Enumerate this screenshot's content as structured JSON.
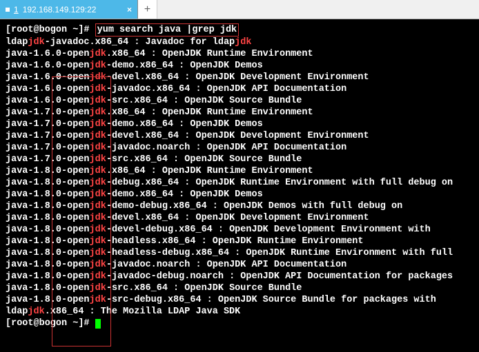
{
  "tab": {
    "index": "1",
    "label": "192.168.149.129:22",
    "close": "×"
  },
  "newtab": "+",
  "prompt": "[root@bogon ~]# ",
  "command": "yum search java |grep jdk",
  "lines": [
    {
      "pre": "ldap",
      "hl": "jdk",
      "mid": "-javadoc.x86_64 : Javadoc for ldap",
      "hl2": "jdk",
      "post": ""
    },
    {
      "pre": "java-1.6.0-open",
      "hl": "jdk",
      "mid": ".x86_64 : OpenJDK Runtime Environment",
      "hl2": "",
      "post": ""
    },
    {
      "pre": "java-1.6.0-open",
      "hl": "jdk",
      "mid": "-demo.x86_64 : OpenJDK Demos",
      "hl2": "",
      "post": ""
    },
    {
      "pre": "java-1.6.0-open",
      "hl": "jdk",
      "mid": "-devel.x86_64 : OpenJDK Development Environment",
      "hl2": "",
      "post": ""
    },
    {
      "pre": "java-1.6.0-open",
      "hl": "jdk",
      "mid": "-javadoc.x86_64 : OpenJDK API Documentation",
      "hl2": "",
      "post": ""
    },
    {
      "pre": "java-1.6.0-open",
      "hl": "jdk",
      "mid": "-src.x86_64 : OpenJDK Source Bundle",
      "hl2": "",
      "post": ""
    },
    {
      "pre": "java-1.7.0-open",
      "hl": "jdk",
      "mid": ".x86_64 : OpenJDK Runtime Environment",
      "hl2": "",
      "post": ""
    },
    {
      "pre": "java-1.7.0-open",
      "hl": "jdk",
      "mid": "-demo.x86_64 : OpenJDK Demos",
      "hl2": "",
      "post": ""
    },
    {
      "pre": "java-1.7.0-open",
      "hl": "jdk",
      "mid": "-devel.x86_64 : OpenJDK Development Environment",
      "hl2": "",
      "post": ""
    },
    {
      "pre": "java-1.7.0-open",
      "hl": "jdk",
      "mid": "-javadoc.noarch : OpenJDK API Documentation",
      "hl2": "",
      "post": ""
    },
    {
      "pre": "java-1.7.0-open",
      "hl": "jdk",
      "mid": "-src.x86_64 : OpenJDK Source Bundle",
      "hl2": "",
      "post": ""
    },
    {
      "pre": "java-1.8.0-open",
      "hl": "jdk",
      "mid": ".x86_64 : OpenJDK Runtime Environment",
      "hl2": "",
      "post": ""
    },
    {
      "pre": "java-1.8.0-open",
      "hl": "jdk",
      "mid": "-debug.x86_64 : OpenJDK Runtime Environment with full debug on",
      "hl2": "",
      "post": ""
    },
    {
      "pre": "java-1.8.0-open",
      "hl": "jdk",
      "mid": "-demo.x86_64 : OpenJDK Demos",
      "hl2": "",
      "post": ""
    },
    {
      "pre": "java-1.8.0-open",
      "hl": "jdk",
      "mid": "-demo-debug.x86_64 : OpenJDK Demos with full debug on",
      "hl2": "",
      "post": ""
    },
    {
      "pre": "java-1.8.0-open",
      "hl": "jdk",
      "mid": "-devel.x86_64 : OpenJDK Development Environment",
      "hl2": "",
      "post": ""
    },
    {
      "pre": "java-1.8.0-open",
      "hl": "jdk",
      "mid": "-devel-debug.x86_64 : OpenJDK Development Environment with",
      "hl2": "",
      "post": ""
    },
    {
      "pre": "java-1.8.0-open",
      "hl": "jdk",
      "mid": "-headless.x86_64 : OpenJDK Runtime Environment",
      "hl2": "",
      "post": ""
    },
    {
      "pre": "java-1.8.0-open",
      "hl": "jdk",
      "mid": "-headless-debug.x86_64 : OpenJDK Runtime Environment with full",
      "hl2": "",
      "post": ""
    },
    {
      "pre": "java-1.8.0-open",
      "hl": "jdk",
      "mid": "-javadoc.noarch : OpenJDK API Documentation",
      "hl2": "",
      "post": ""
    },
    {
      "pre": "java-1.8.0-open",
      "hl": "jdk",
      "mid": "-javadoc-debug.noarch : OpenJDK API Documentation for packages",
      "hl2": "",
      "post": ""
    },
    {
      "pre": "java-1.8.0-open",
      "hl": "jdk",
      "mid": "-src.x86_64 : OpenJDK Source Bundle",
      "hl2": "",
      "post": ""
    },
    {
      "pre": "java-1.8.0-open",
      "hl": "jdk",
      "mid": "-src-debug.x86_64 : OpenJDK Source Bundle for packages with",
      "hl2": "",
      "post": ""
    },
    {
      "pre": "ldap",
      "hl": "jdk",
      "mid": ".x86_64 : The Mozilla LDAP Java SDK",
      "hl2": "",
      "post": ""
    }
  ]
}
